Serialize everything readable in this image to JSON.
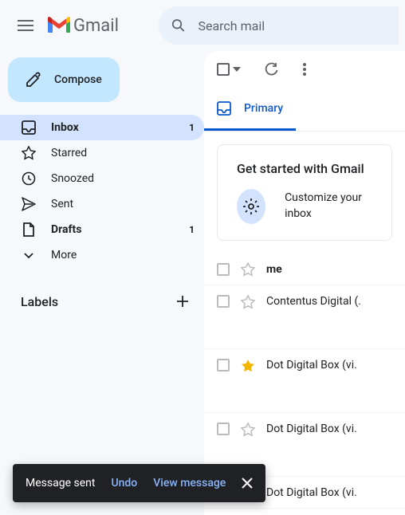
{
  "header": {
    "product": "Gmail",
    "search_placeholder": "Search mail"
  },
  "compose": {
    "label": "Compose"
  },
  "nav": {
    "inbox": {
      "label": "Inbox",
      "count": "1"
    },
    "starred": {
      "label": "Starred"
    },
    "snoozed": {
      "label": "Snoozed"
    },
    "sent": {
      "label": "Sent"
    },
    "drafts": {
      "label": "Drafts",
      "count": "1"
    },
    "more": {
      "label": "More"
    }
  },
  "labels": {
    "title": "Labels"
  },
  "tabs": {
    "primary": "Primary"
  },
  "get_started": {
    "title": "Get started with Gmail",
    "customize": "Customize your inbox"
  },
  "emails": [
    {
      "sender": "me",
      "bold": true,
      "starred": false
    },
    {
      "sender": "Contentus Digital (.",
      "bold": false,
      "starred": false
    },
    {
      "sender": "Dot Digital Box (vi.",
      "bold": false,
      "starred": true
    },
    {
      "sender": "Dot Digital Box (vi.",
      "bold": false,
      "starred": false
    },
    {
      "sender": "Dot Digital Box (vi.",
      "bold": false,
      "starred": false
    }
  ],
  "toast": {
    "message": "Message sent",
    "undo": "Undo",
    "view": "View message"
  }
}
